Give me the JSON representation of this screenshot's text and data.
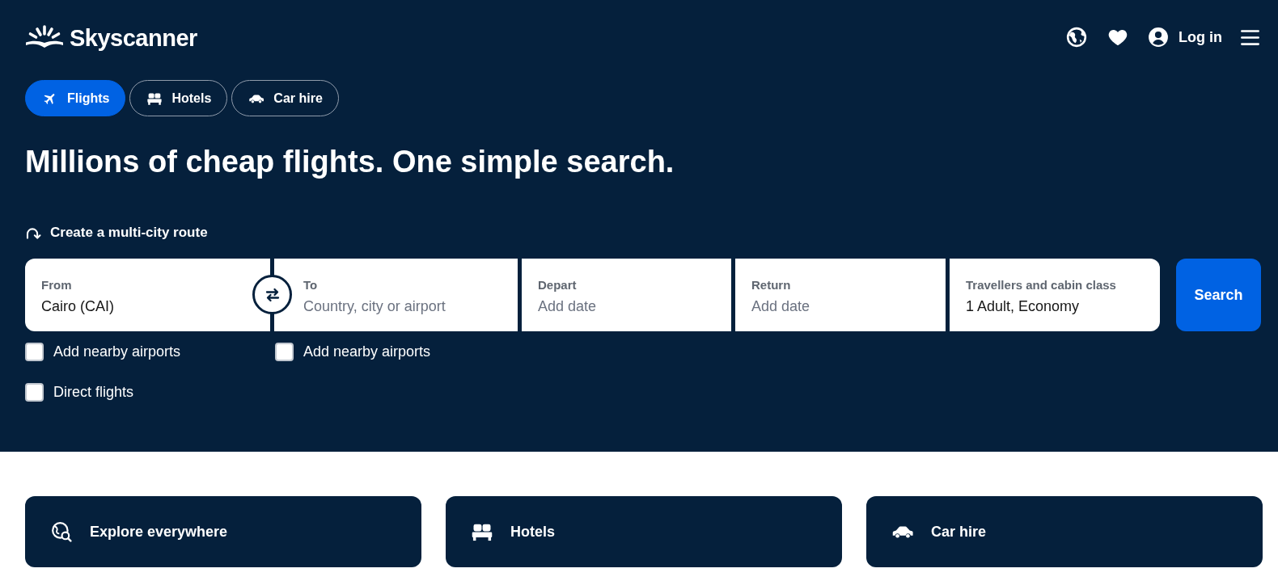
{
  "header": {
    "logo": "Skyscanner",
    "login": "Log in"
  },
  "tabs": [
    {
      "label": "Flights",
      "kind": "flights",
      "selected": true
    },
    {
      "label": "Hotels",
      "kind": "hotels",
      "selected": false
    },
    {
      "label": "Car hire",
      "kind": "car_hire",
      "selected": false
    }
  ],
  "headline": "Millions of cheap flights. One simple search.",
  "multi_city_link": "Create a multi-city route",
  "search_form": {
    "fields": [
      {
        "label": "From",
        "value": "Cairo (CAI)"
      },
      {
        "label": "To",
        "placeholder": "Country, city or airport"
      },
      {
        "label": "Depart",
        "placeholder": "Add date"
      },
      {
        "label": "Return",
        "placeholder": "Add date"
      },
      {
        "label": "Travellers and cabin class",
        "value": "1 Adult, Economy"
      }
    ],
    "search_button": "Search",
    "options": [
      {
        "label": "Add nearby airports",
        "checked": false
      },
      {
        "label": "Add nearby airports",
        "checked": false
      },
      {
        "label": "Direct flights",
        "checked": false
      }
    ]
  },
  "quick_links": [
    {
      "label": "Explore everywhere",
      "kind": "explore"
    },
    {
      "label": "Hotels",
      "kind": "hotels"
    },
    {
      "label": "Car hire",
      "kind": "car_hire"
    }
  ]
}
